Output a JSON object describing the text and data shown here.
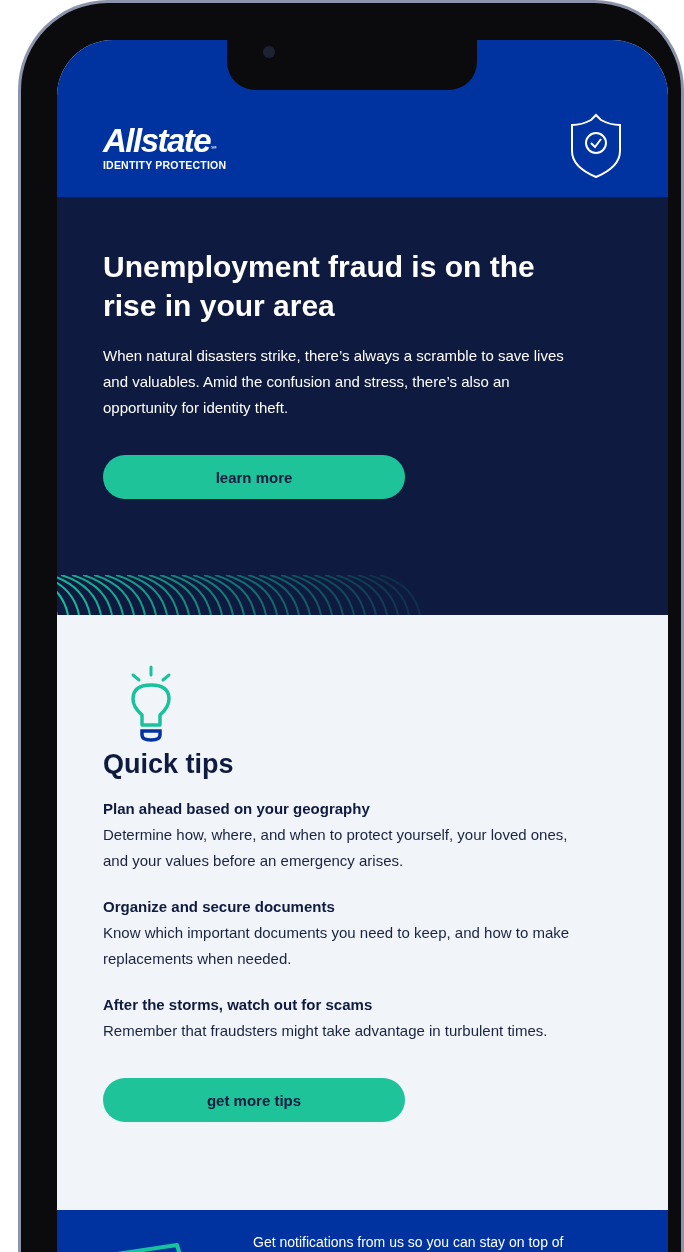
{
  "brand": {
    "name": "Allstate",
    "mark": "℠",
    "subtitle": "IDENTITY PROTECTION"
  },
  "hero": {
    "title": "Unemployment fraud is on the rise in your area",
    "body": "When natural disasters strike, there’s always a scramble to save lives and valuables. Amid the confusion and stress, there’s also an opportunity for identity theft.",
    "button": "learn more"
  },
  "tips": {
    "heading": "Quick tips",
    "items": [
      {
        "title": "Plan ahead based on your geography",
        "body": "Determine how, where, and when to protect yourself, your loved ones, and your values before an emergency arises."
      },
      {
        "title": "Organize and secure documents",
        "body": "Know which important documents you need to keep, and how to make replacements when needed."
      },
      {
        "title": "After the storms, watch out for scams",
        "body": "Remember that fraudsters might take advantage in turbulent times."
      }
    ],
    "button": "get more tips"
  },
  "footer": {
    "text": "Get notifications from us so you can stay on top of"
  }
}
